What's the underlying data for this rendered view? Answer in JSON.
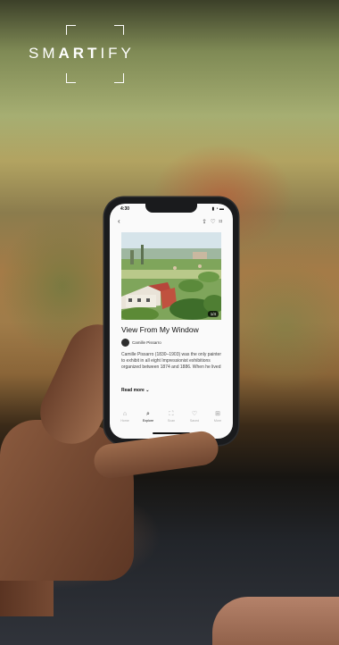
{
  "brand": {
    "prefix": "SM",
    "highlight": "ART",
    "suffix": "IFY"
  },
  "phone": {
    "status_time": "4:30",
    "status_icons": "▮ ◔ ▬",
    "topbar": {
      "back_icon": "chevron-left-icon",
      "action_icons": [
        "share-icon",
        "heart-icon",
        "bookmark-icon"
      ]
    },
    "artwork": {
      "image_count": "1/4"
    },
    "title": "View From My Window",
    "artist": "Camille Pissarro",
    "description": "Camille Pissarro (1830–1903) was the only painter to exhibit in all eight Impressionist exhibitions organized between 1874 and 1886. When he lived",
    "read_more": "Read more",
    "tabs": [
      {
        "label": "Home",
        "icon": "home-icon",
        "active": false
      },
      {
        "label": "Explore",
        "icon": "search-icon",
        "active": true
      },
      {
        "label": "Scan",
        "icon": "scan-icon",
        "active": false
      },
      {
        "label": "Saved",
        "icon": "heart-icon",
        "active": false
      },
      {
        "label": "More",
        "icon": "grid-icon",
        "active": false
      }
    ]
  },
  "colors": {
    "accent": "#111111",
    "screen_bg": "#fafafa"
  }
}
